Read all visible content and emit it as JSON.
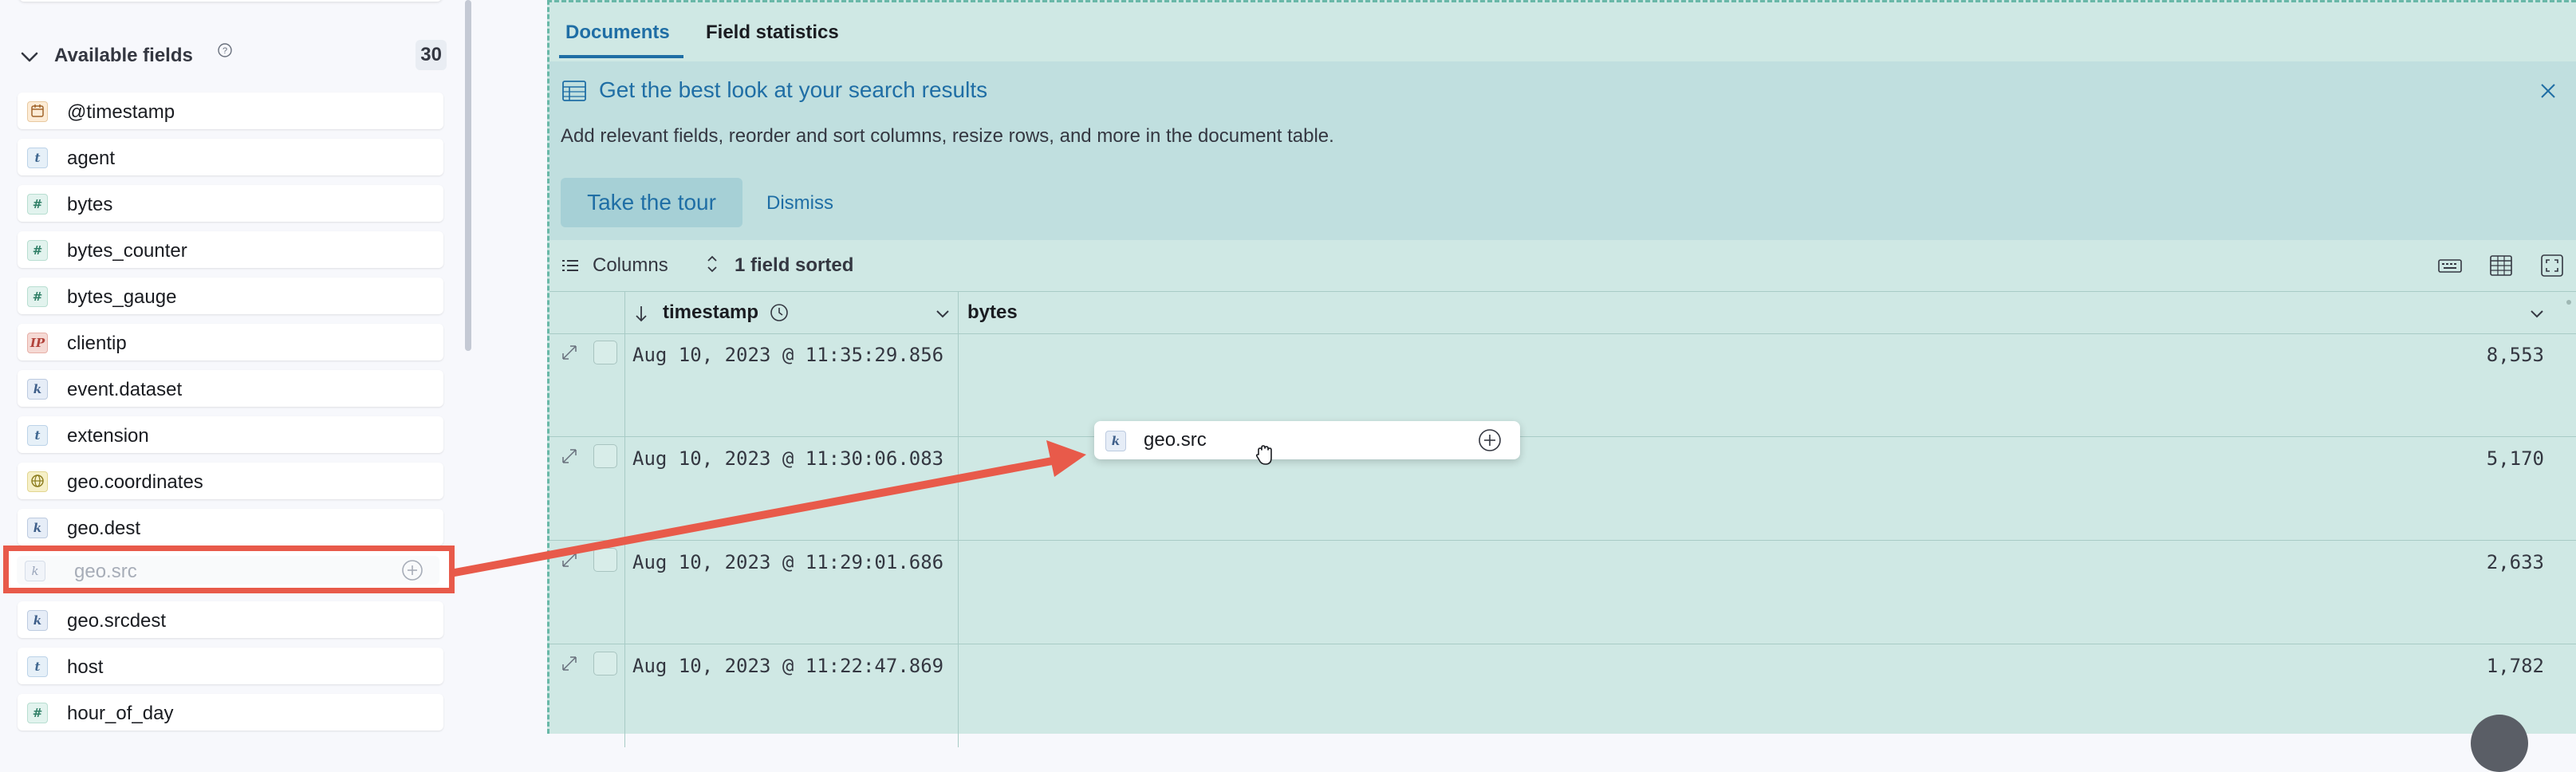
{
  "sidebar": {
    "available_fields": {
      "title": "Available fields",
      "count": "30"
    },
    "fields": [
      {
        "name": "@timestamp",
        "type": "date",
        "token": ""
      },
      {
        "name": "agent",
        "type": "text",
        "token": "t"
      },
      {
        "name": "bytes",
        "type": "number",
        "token": "#"
      },
      {
        "name": "bytes_counter",
        "type": "number",
        "token": "#"
      },
      {
        "name": "bytes_gauge",
        "type": "number",
        "token": "#"
      },
      {
        "name": "clientip",
        "type": "ip",
        "token": "IP"
      },
      {
        "name": "event.dataset",
        "type": "keyword",
        "token": "k"
      },
      {
        "name": "extension",
        "type": "text",
        "token": "t"
      },
      {
        "name": "geo.coordinates",
        "type": "geo",
        "token": ""
      },
      {
        "name": "geo.dest",
        "type": "keyword",
        "token": "k"
      },
      {
        "name": "geo.src",
        "type": "keyword",
        "token": "k",
        "dragging": true
      },
      {
        "name": "geo.srcdest",
        "type": "keyword",
        "token": "k"
      },
      {
        "name": "host",
        "type": "text",
        "token": "t"
      },
      {
        "name": "hour_of_day",
        "type": "number",
        "token": "#"
      }
    ]
  },
  "main": {
    "tabs": [
      {
        "label": "Documents",
        "active": true
      },
      {
        "label": "Field statistics",
        "active": false
      }
    ],
    "callout": {
      "title": "Get the best look at your search results",
      "body": "Add relevant fields, reorder and sort columns, resize rows, and more in the document table.",
      "primary_button": "Take the tour",
      "secondary_button": "Dismiss"
    },
    "toolbar": {
      "columns_label": "Columns",
      "sorted_label": "1 field sorted"
    },
    "grid": {
      "columns": [
        "timestamp",
        "bytes"
      ],
      "rows": [
        {
          "timestamp": "Aug 10, 2023 @ 11:35:29.856",
          "bytes": "8,553"
        },
        {
          "timestamp": "Aug 10, 2023 @ 11:30:06.083",
          "bytes": "5,170"
        },
        {
          "timestamp": "Aug 10, 2023 @ 11:29:01.686",
          "bytes": "2,633"
        },
        {
          "timestamp": "Aug 10, 2023 @ 11:22:47.869",
          "bytes": "1,782"
        }
      ]
    },
    "drag_preview": {
      "token": "k",
      "field": "geo.src"
    }
  },
  "colors": {
    "accent": "#1f6ea5",
    "drop_zone_bg": "#cfe8e4",
    "annotation_red": "#e85a4a"
  },
  "icons": {
    "avail_chevron": "chevron-down-icon",
    "help": "question-circle-icon",
    "callout": "table-icon",
    "close": "close-icon",
    "columns": "list-icon",
    "sort": "sort-icon",
    "keyboard": "keyboard-icon",
    "density": "table-density-icon",
    "fullscreen": "fullscreen-icon",
    "expand": "expand-icon",
    "add": "plus-circle-icon",
    "clock": "clock-icon"
  }
}
